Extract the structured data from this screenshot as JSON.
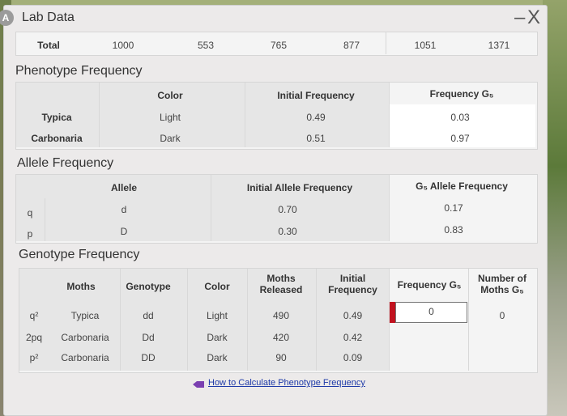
{
  "window": {
    "title": "Lab Data",
    "icon": "app-icon",
    "close_label": "– X"
  },
  "totals": {
    "label": "Total",
    "values": [
      "1000",
      "553",
      "765",
      "877",
      "1051",
      "1371"
    ]
  },
  "phenotype": {
    "heading": "Phenotype Frequency",
    "headers": {
      "color": "Color",
      "initial": "Initial Frequency",
      "freq_gs": "Frequency G₅"
    },
    "rows": [
      {
        "name": "Typica",
        "color": "Light",
        "initial": "0.49",
        "freq_gs": "0.03"
      },
      {
        "name": "Carbonaria",
        "color": "Dark",
        "initial": "0.51",
        "freq_gs": "0.97"
      }
    ]
  },
  "allele": {
    "heading": "Allele Frequency",
    "headers": {
      "allele": "Allele",
      "initial": "Initial Allele Frequency",
      "gs": "G₅ Allele Frequency"
    },
    "rows": [
      {
        "symbol": "q",
        "allele": "d",
        "initial": "0.70",
        "gs": "0.17"
      },
      {
        "symbol": "p",
        "allele": "D",
        "initial": "0.30",
        "gs": "0.83"
      }
    ]
  },
  "genotype": {
    "heading": "Genotype Frequency",
    "headers": {
      "moths": "Moths",
      "genotype": "Genotype",
      "color": "Color",
      "released_1": "Moths",
      "released_2": "Released",
      "initial_1": "Initial",
      "initial_2": "Frequency",
      "freq_gs": "Frequency G₅",
      "number_1": "Number of",
      "number_2": "Moths G₅"
    },
    "rows": [
      {
        "symbol": "q²",
        "moth": "Typica",
        "genotype": "dd",
        "color": "Light",
        "released": "490",
        "initial": "0.49",
        "freq_gs_input": "0",
        "number": "0"
      },
      {
        "symbol": "2pq",
        "moth": "Carbonaria",
        "genotype": "Dd",
        "color": "Dark",
        "released": "420",
        "initial": "0.42",
        "freq_gs_input": "",
        "number": ""
      },
      {
        "symbol": "p²",
        "moth": "Carbonaria",
        "genotype": "DD",
        "color": "Dark",
        "released": "90",
        "initial": "0.09",
        "freq_gs_input": "",
        "number": ""
      }
    ]
  },
  "help_link": "How to Calculate Phenotype Frequency"
}
